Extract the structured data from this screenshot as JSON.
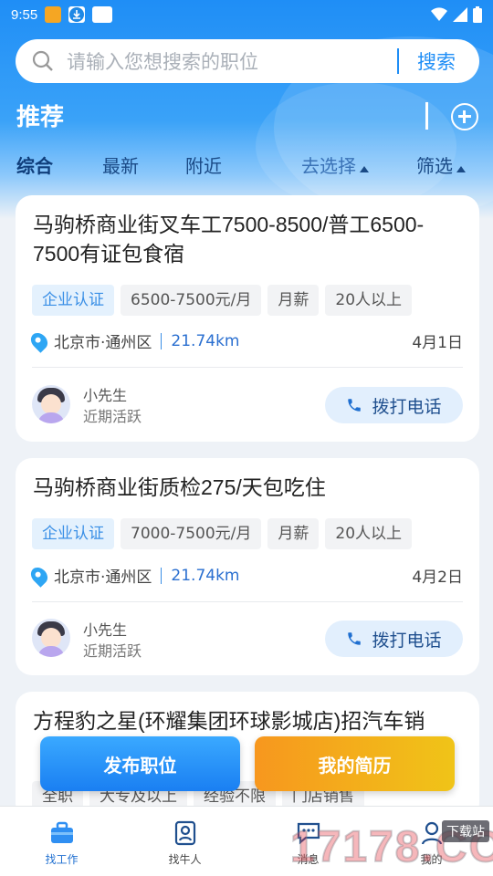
{
  "status_bar": {
    "time": "9:55"
  },
  "search": {
    "placeholder": "请输入您想搜索的职位",
    "button_label": "搜索"
  },
  "header": {
    "title": "推荐"
  },
  "tabs": [
    {
      "label": "综合",
      "active": true
    },
    {
      "label": "最新",
      "active": false
    },
    {
      "label": "附近",
      "active": false
    },
    {
      "label": "去选择",
      "active": false
    },
    {
      "label": "筛选",
      "active": false
    }
  ],
  "jobs": [
    {
      "title": "马驹桥商业街叉车工7500-8500/普工6500-7500有证包食宿",
      "tags": [
        "企业认证",
        "6500-7500元/月",
        "月薪",
        "20人以上"
      ],
      "location": "北京市·通州区",
      "distance": "21.74km",
      "date": "4月1日",
      "recruiter": "小先生",
      "recruiter_status": "近期活跃",
      "call_label": "拨打电话"
    },
    {
      "title": "马驹桥商业街质检275/天包吃住",
      "tags": [
        "企业认证",
        "7000-7500元/月",
        "月薪",
        "20人以上"
      ],
      "location": "北京市·通州区",
      "distance": "21.74km",
      "date": "4月2日",
      "recruiter": "小先生",
      "recruiter_status": "近期活跃",
      "call_label": "拨打电话"
    },
    {
      "title": "方程豹之星(环耀集团环球影城店)招汽车销",
      "tags": [
        "全职",
        "大专及以上",
        "经验不限",
        "门店销售"
      ]
    }
  ],
  "floating_actions": {
    "publish_label": "发布职位",
    "resume_label": "我的简历"
  },
  "bottom_nav": [
    {
      "label": "找工作",
      "icon": "briefcase-icon",
      "active": true
    },
    {
      "label": "找牛人",
      "icon": "id-card-icon",
      "active": false
    },
    {
      "label": "消息",
      "icon": "chat-icon",
      "active": false
    },
    {
      "label": "我的",
      "icon": "person-icon",
      "active": false
    }
  ],
  "watermark": {
    "text": "17178.COM",
    "tag": "下载站"
  },
  "colors": {
    "primary": "#1f8ef6",
    "tag_cert_bg": "#e4f1fd",
    "orange": "#f7971e"
  }
}
